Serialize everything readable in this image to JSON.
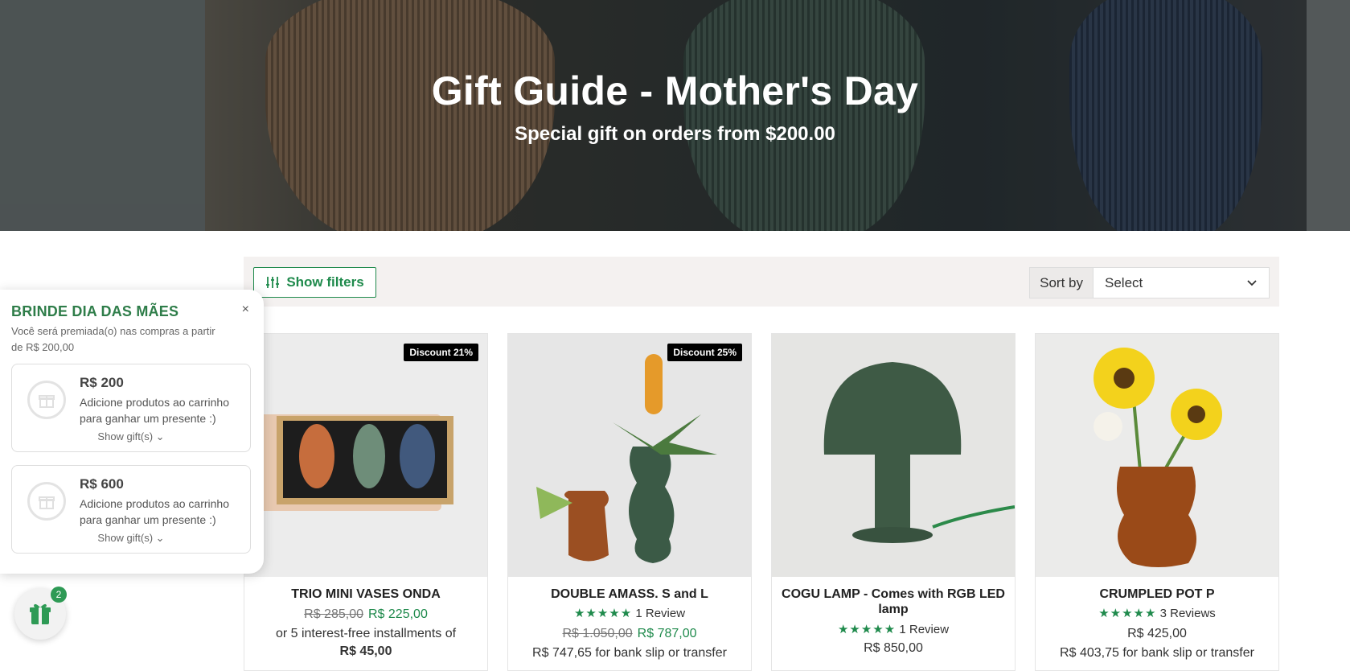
{
  "hero": {
    "title": "Gift Guide - Mother's Day",
    "subtitle": "Special gift on orders from $200.00"
  },
  "toolbar": {
    "filters_label": "Show filters",
    "sort_label": "Sort by",
    "sort_value": "Select"
  },
  "products": [
    {
      "name": "TRIO MINI VASES ONDA",
      "badge": "Discount 21%",
      "old_price": "R$ 285,00",
      "price": "R$ 225,00",
      "installments": "or 5 interest-free installments of",
      "installment_value": "R$ 45,00"
    },
    {
      "name": "DOUBLE AMASS. S and L",
      "badge": "Discount 25%",
      "stars": "★★★★★",
      "reviews": "1 Review",
      "old_price": "R$ 1.050,00",
      "price": "R$ 787,00",
      "installments": "R$ 747,65 for bank slip or transfer"
    },
    {
      "name": "COGU LAMP - Comes with RGB LED lamp",
      "stars": "★★★★★",
      "reviews": "1 Review",
      "price": "R$ 850,00"
    },
    {
      "name": "CRUMPLED POT P",
      "stars": "★★★★★",
      "reviews": "3 Reviews",
      "price": "R$ 425,00",
      "installments": "R$ 403,75 for bank slip or transfer"
    }
  ],
  "gift_panel": {
    "title": "BRINDE DIA DAS MÃES",
    "close": "×",
    "description": "Você será premiada(o) nas compras a partir de R$ 200,00",
    "tiers": [
      {
        "amount": "R$ 200",
        "message": "Adicione produtos ao carrinho para ganhar um presente :)",
        "show": "Show gift(s) ⌄"
      },
      {
        "amount": "R$ 600",
        "message": "Adicione produtos ao carrinho para ganhar um presente :)",
        "show": "Show gift(s) ⌄"
      }
    ],
    "fab_count": "2"
  },
  "colors": {
    "accent": "#1f8a4c",
    "gift_title": "#2e7d49"
  }
}
